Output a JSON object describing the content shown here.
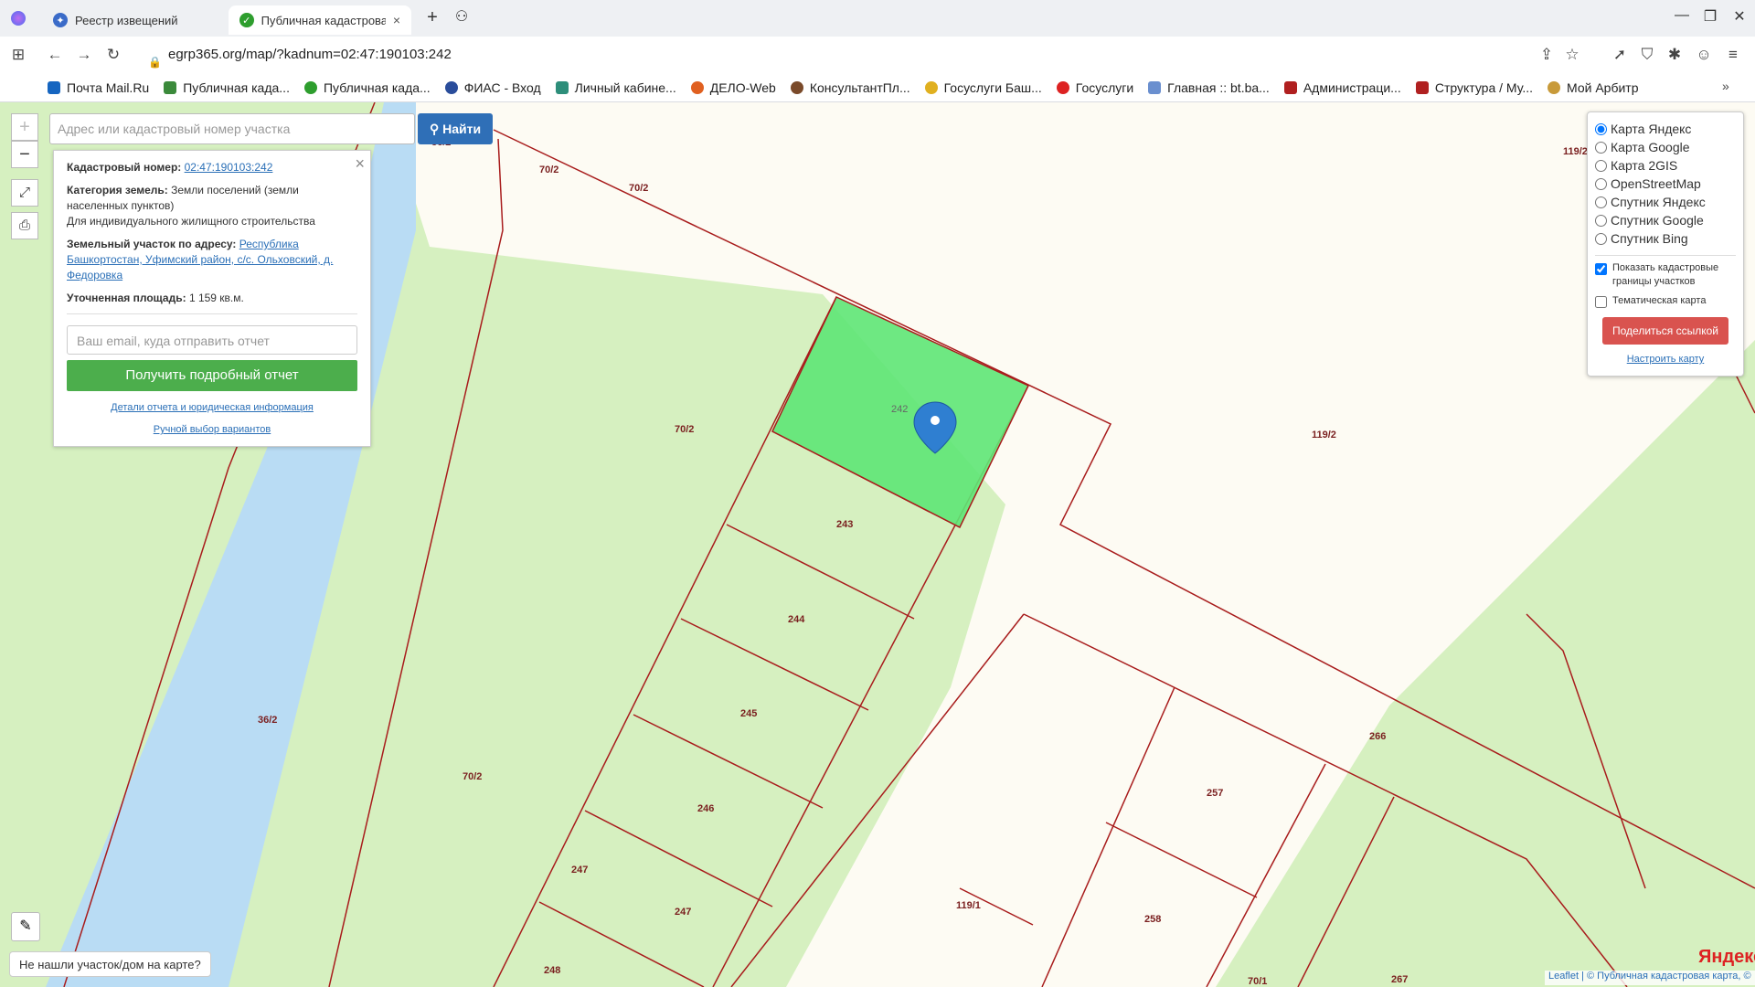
{
  "browser": {
    "tabs": [
      {
        "title": "Реестр извещений",
        "active": false,
        "icon": "shield-icon"
      },
      {
        "title": "Публичная кадастровая кар",
        "active": true,
        "icon": "check-icon"
      }
    ],
    "url": "egrp365.org/map/?kadnum=02:47:190103:242",
    "bookmarks": [
      {
        "label": "Почта Mail.Ru",
        "color": "#1565c0"
      },
      {
        "label": "Публичная када...",
        "color": "#3b8a3b"
      },
      {
        "label": "Публичная када...",
        "color": "#2e9e2e"
      },
      {
        "label": "ФИАС - Вход",
        "color": "#2a4d9b"
      },
      {
        "label": "Личный кабине...",
        "color": "#2d8e7a"
      },
      {
        "label": "ДЕЛО-Web",
        "color": "#e06020"
      },
      {
        "label": "КонсультантПл...",
        "color": "#7a4a2a"
      },
      {
        "label": "Госуслуги Баш...",
        "color": "#e0b020"
      },
      {
        "label": "Госуслуги",
        "color": "#d22"
      },
      {
        "label": "Главная :: bt.ba...",
        "color": "#6a8fcf"
      },
      {
        "label": "Администраци...",
        "color": "#b02020"
      },
      {
        "label": "Структура / Му...",
        "color": "#b02020"
      },
      {
        "label": "Мой Арбитр",
        "color": "#c89a3a"
      }
    ]
  },
  "map": {
    "search_placeholder": "Адрес или кадастровый номер участка",
    "find_label": "Найти",
    "info": {
      "cadnum_label": "Кадастровый номер:",
      "cadnum": "02:47:190103:242",
      "category_label": "Категория земель:",
      "category": "Земли поселений (земли населенных пунктов)",
      "use": "Для индивидуального жилищного строительства",
      "address_label": "Земельный участок по адресу:",
      "address": "Республика Башкортостан, Уфимский район, с/с. Ольховский, д. Федоровка",
      "area_label": "Уточненная площадь:",
      "area": "1 159 кв.м.",
      "email_placeholder": "Ваш email, куда отправить отчет",
      "report_button": "Получить подробный отчет",
      "details_link": "Детали отчета и юридическая информация",
      "manual_link": "Ручной выбор вариантов"
    },
    "layers": {
      "options": [
        "Карта Яндекс",
        "Карта Google",
        "Карта 2GIS",
        "OpenStreetMap",
        "Спутник Яндекс",
        "Спутник Google",
        "Спутник Bing"
      ],
      "selected": "Карта Яндекс",
      "show_borders": "Показать кадастровые границы участков",
      "thematic": "Тематическая карта",
      "share_button": "Поделиться ссылкой",
      "setup_link": "Настроить карту"
    },
    "not_found": "Не нашли участок/дом на карте?",
    "brand": "Яндекс",
    "attribution": "Leaflet | © Публичная кадастровая карта, ©",
    "parcel_labels": [
      {
        "text": "36/2"
      },
      {
        "text": "70/2"
      },
      {
        "text": "70/2"
      },
      {
        "text": "119/2"
      },
      {
        "text": "242"
      },
      {
        "text": "70/2"
      },
      {
        "text": "119/2"
      },
      {
        "text": "243"
      },
      {
        "text": "244"
      },
      {
        "text": "245"
      },
      {
        "text": "36/2"
      },
      {
        "text": "266"
      },
      {
        "text": "70/2"
      },
      {
        "text": "246"
      },
      {
        "text": "257"
      },
      {
        "text": "247"
      },
      {
        "text": "247"
      },
      {
        "text": "119/1"
      },
      {
        "text": "258"
      },
      {
        "text": "248"
      },
      {
        "text": "70/1"
      },
      {
        "text": "267"
      }
    ]
  }
}
